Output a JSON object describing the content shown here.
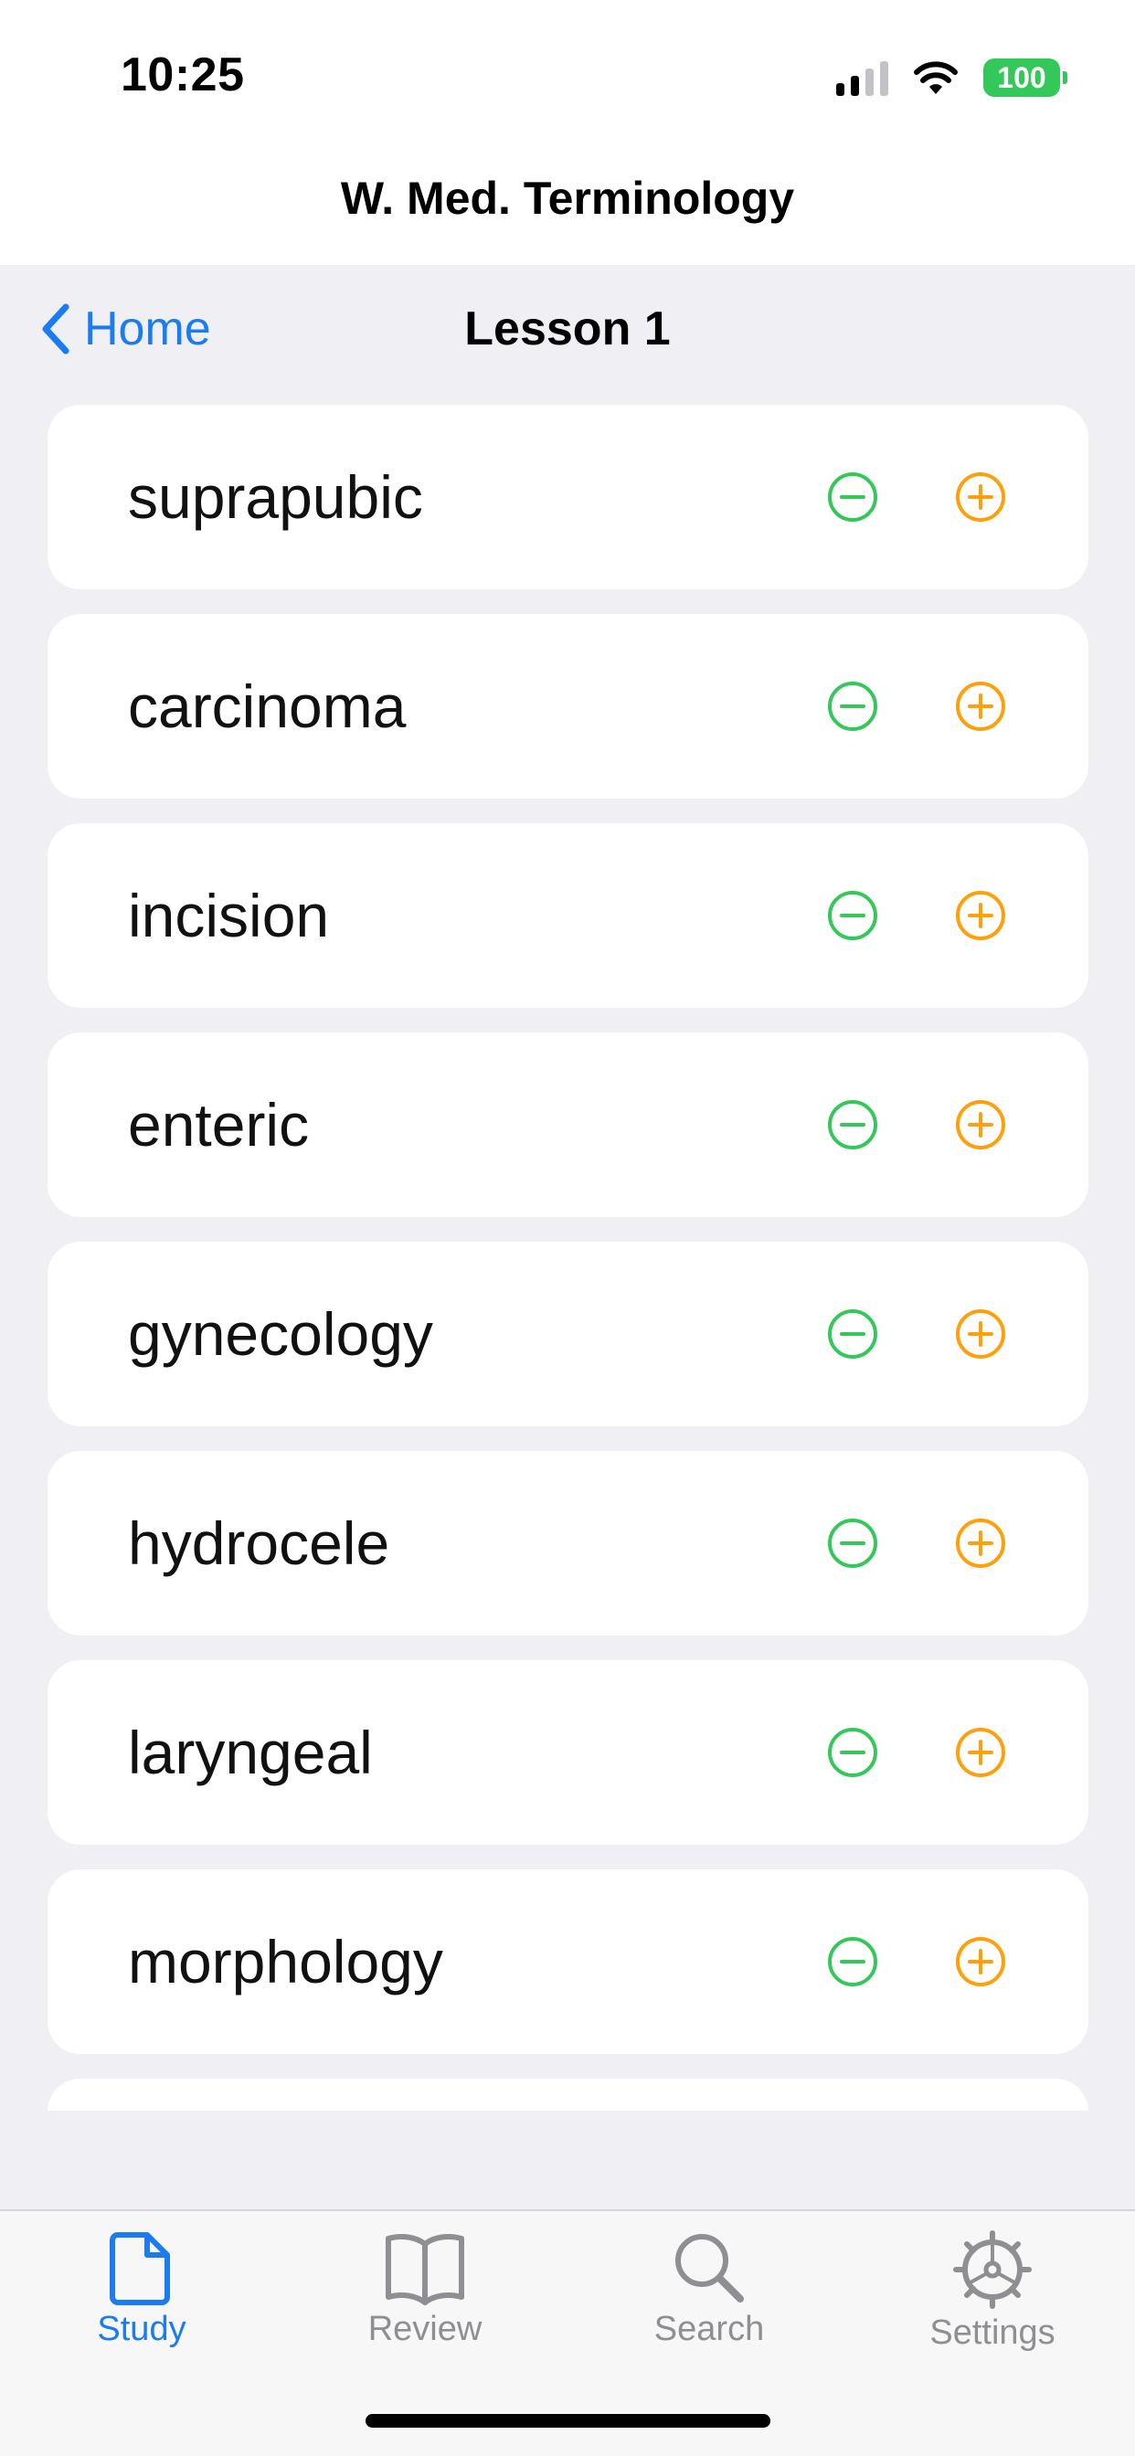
{
  "status_bar": {
    "time": "10:25",
    "battery": "100"
  },
  "app": {
    "title": "W. Med. Terminology"
  },
  "nav": {
    "back_label": "Home",
    "title": "Lesson 1"
  },
  "terms": [
    {
      "word": "suprapubic"
    },
    {
      "word": "carcinoma"
    },
    {
      "word": "incision"
    },
    {
      "word": "enteric"
    },
    {
      "word": "gynecology"
    },
    {
      "word": "hydrocele"
    },
    {
      "word": "laryngeal"
    },
    {
      "word": "morphology"
    },
    {
      "word": ""
    }
  ],
  "icons": {
    "remove": "minus-circle-icon",
    "add": "plus-circle-icon"
  },
  "colors": {
    "accent": "#1a7cf0",
    "remove": "#34c759",
    "add": "#ff9f0a",
    "inactive_tab": "#8e8e93"
  },
  "tabs": [
    {
      "label": "Study",
      "icon": "document-icon",
      "active": true
    },
    {
      "label": "Review",
      "icon": "book-icon",
      "active": false
    },
    {
      "label": "Search",
      "icon": "magnifier-icon",
      "active": false
    },
    {
      "label": "Settings",
      "icon": "gear-icon",
      "active": false
    }
  ]
}
